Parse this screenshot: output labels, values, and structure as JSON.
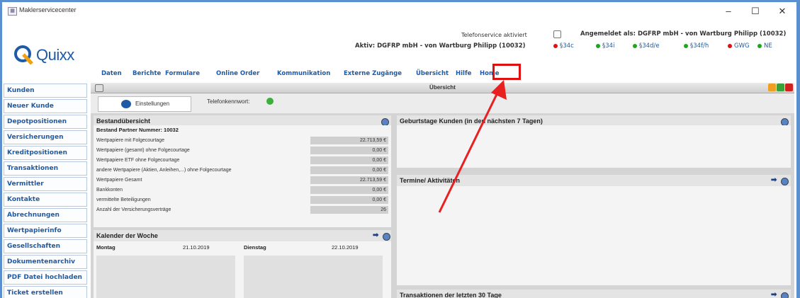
{
  "window": {
    "title": "Maklerservicecenter",
    "controls": {
      "minimize": "–",
      "maximize": "☐",
      "close": "✕"
    }
  },
  "header": {
    "logo_text": "Quixx",
    "logo_sub": "",
    "telefonservice_label": "Telefonservice aktiviert",
    "logged_in": "Angemeldet als: DGFRP mbH - von Wartburg Philipp (10032)",
    "active": "Aktiv: DGFRP mbH - von Wartburg Philipp (10032)",
    "status_items": [
      {
        "label": "§34c",
        "color": "#e01010"
      },
      {
        "label": "§34i",
        "color": "#19a819"
      },
      {
        "label": "§34d/e",
        "color": "#19a819"
      },
      {
        "label": "§34f/h",
        "color": "#19a819"
      },
      {
        "label": "GWG",
        "color": "#e01010"
      },
      {
        "label": "NE",
        "color": "#19a819"
      }
    ]
  },
  "menu": [
    "Daten",
    "Berichte",
    "Formulare",
    "Online Order",
    "Kommunikation",
    "Externe Zugänge",
    "Übersicht",
    "Hilfe",
    "Home"
  ],
  "sidebar": {
    "items": [
      "Kunden",
      "Neuer Kunde",
      "Depotpositionen",
      "Versicherungen",
      "Kreditpositionen",
      "Transaktionen",
      "Vermittler",
      "Kontakte",
      "Abrechnungen",
      "Wertpapierinfo",
      "Gesellschaften",
      "Dokumentenarchiv",
      "PDF Datei hochladen",
      "Ticket erstellen"
    ]
  },
  "main": {
    "title": "Übersicht",
    "settings_button": "Einstellungen",
    "telefonkennwort": "Telefonkennwort:"
  },
  "bestand": {
    "title": "Bestandübersicht",
    "partner": "Bestand Partner Nummer: 10032",
    "rows": [
      {
        "label": "Wertpapiere mit Folgecourtage",
        "value": "22.713,59 €"
      },
      {
        "label": "Wertpapiere (gesamt) ohne Folgecourtage",
        "value": "0,00 €"
      },
      {
        "label": "Wertpapiere ETF ohne Folgecourtage",
        "value": "0,00 €"
      },
      {
        "label": "andere Wertpapiere (Aktien, Anleihen,...) ohne Folgecourtage",
        "value": "0,00 €"
      },
      {
        "label": "Wertpapiere Gesamt",
        "value": "22.713,59 €"
      },
      {
        "label": "Bankkonten",
        "value": "0,00 €"
      },
      {
        "label": "vermittelte Beteiligungen",
        "value": "0,00 €"
      },
      {
        "label": "Anzahl der Versicherungsverträge",
        "value": "26"
      }
    ]
  },
  "kalender": {
    "title": "Kalender der Woche",
    "days": [
      {
        "name": "Montag",
        "date": "21.10.2019"
      },
      {
        "name": "Dienstag",
        "date": "22.10.2019"
      }
    ]
  },
  "geburtstage": {
    "title": "Geburtstage Kunden (in den nächsten 7 Tagen)"
  },
  "termine": {
    "title": "Termine/ Aktivitäten"
  },
  "transaktionen": {
    "title": "Transaktionen der letzten 30 Tage"
  },
  "colors": {
    "accent": "#1e5aa5",
    "highlight": "#e01010",
    "window_border": "#5a8fd0"
  }
}
